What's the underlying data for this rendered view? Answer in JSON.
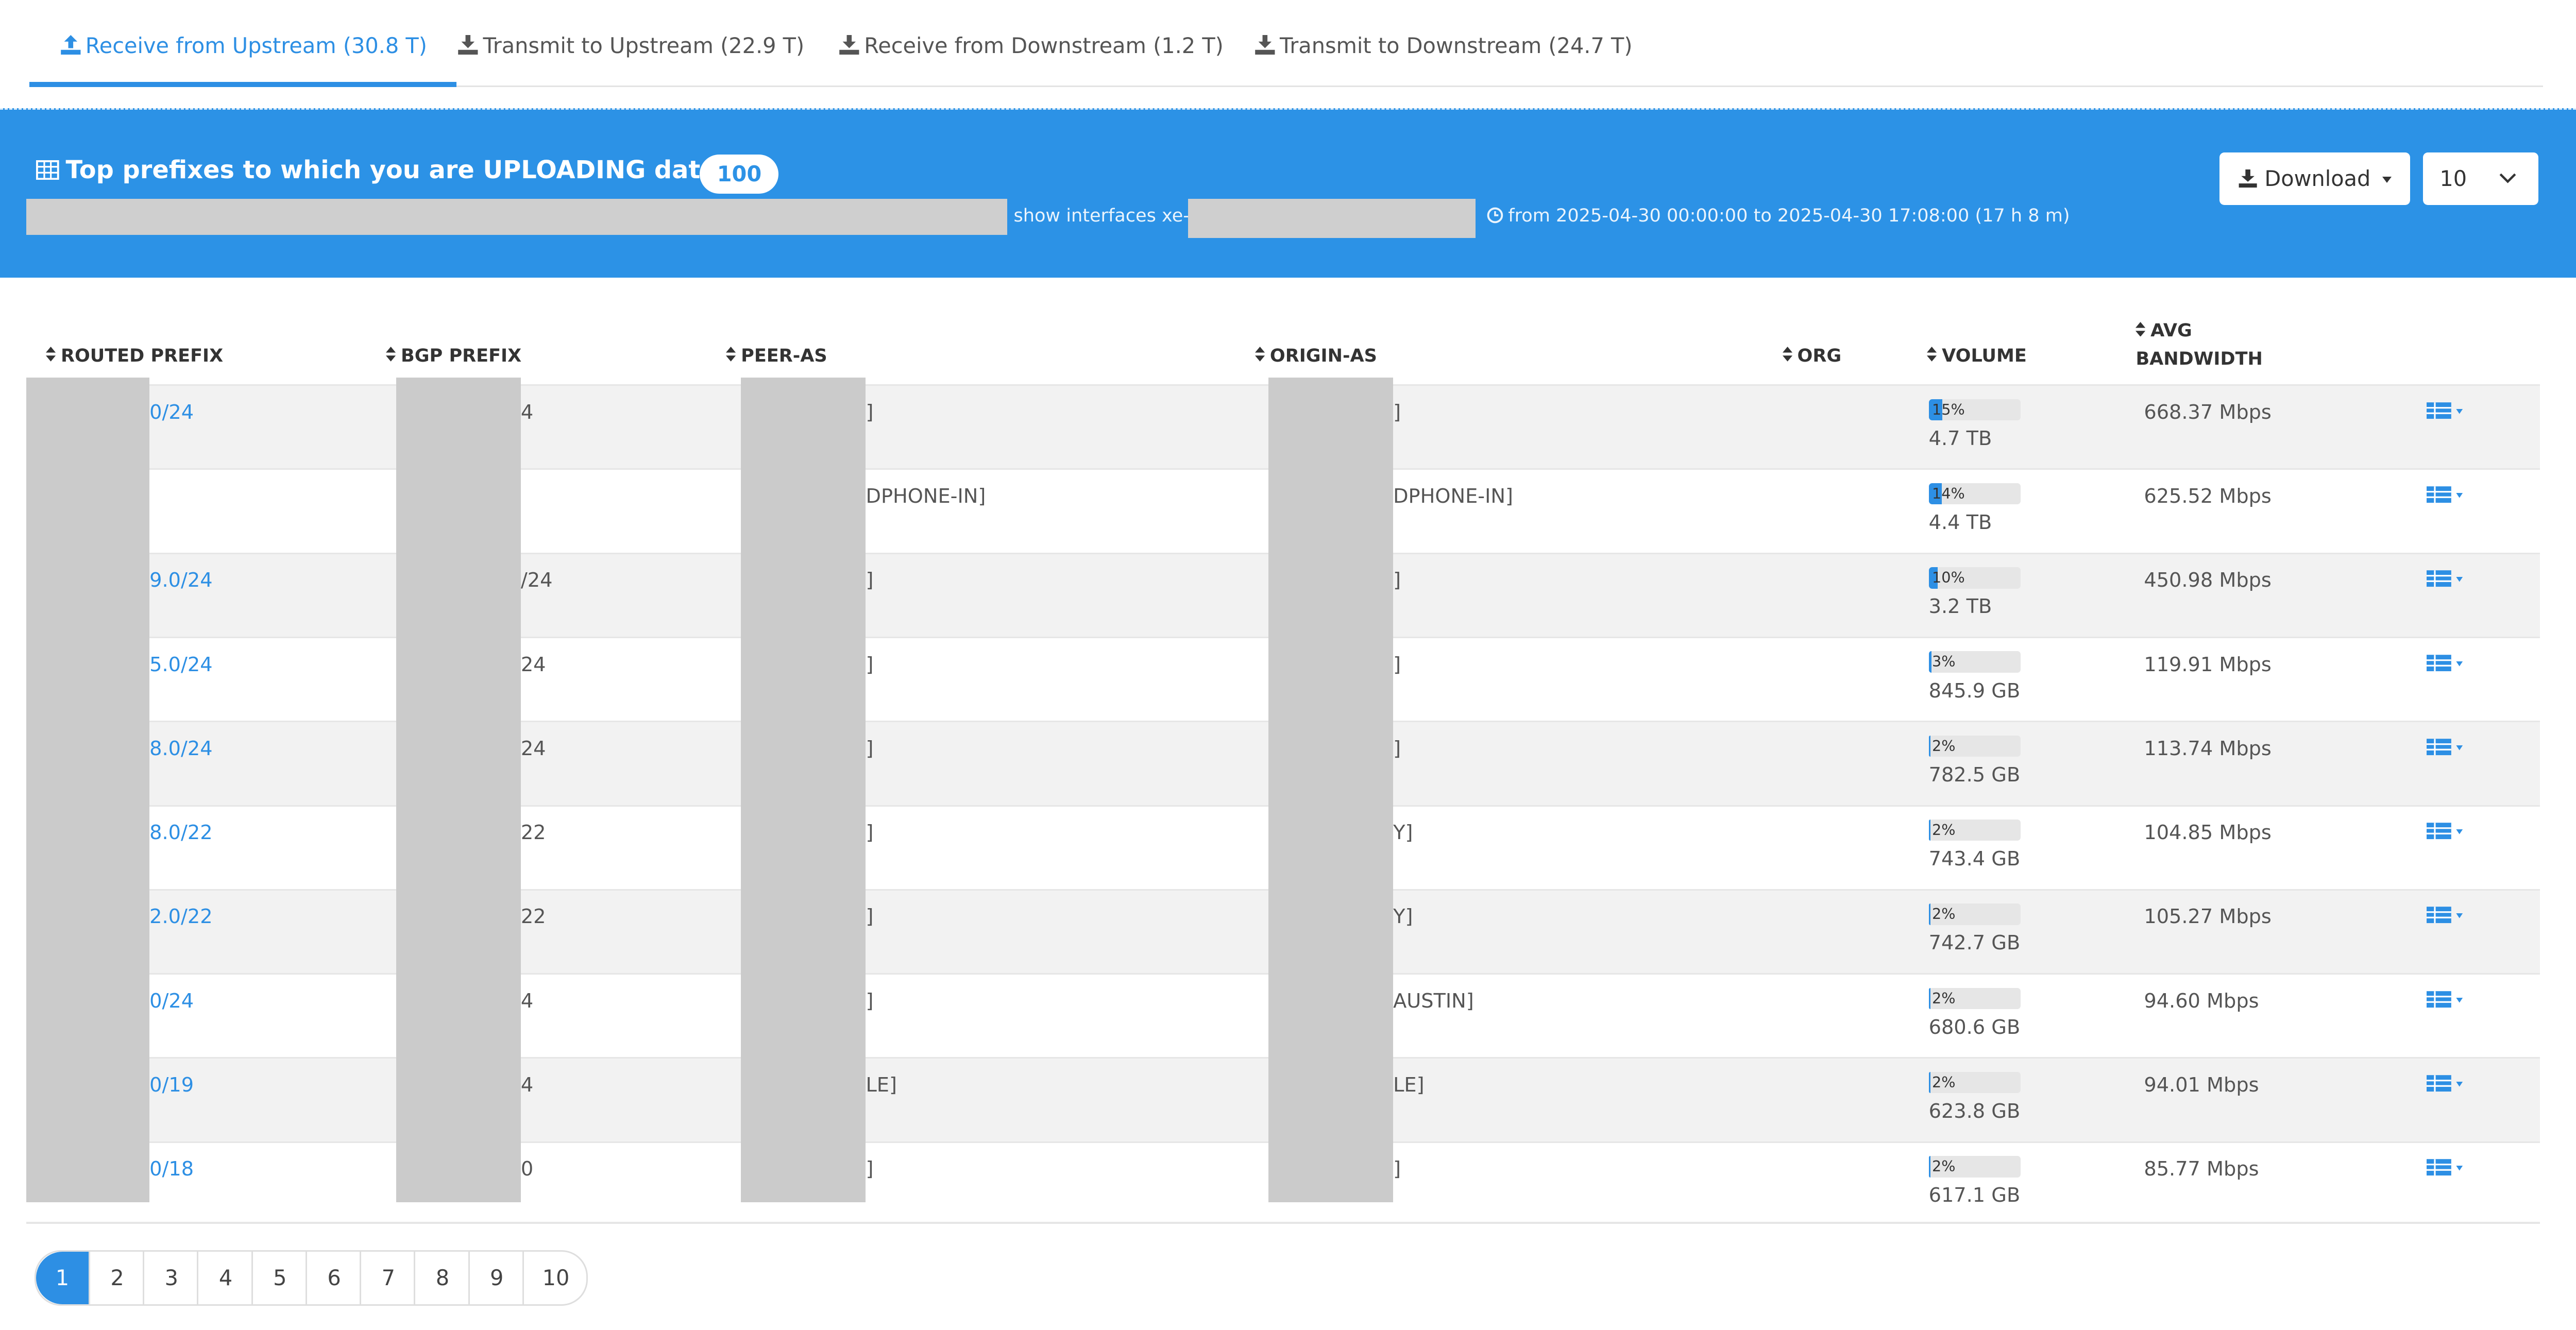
{
  "tabs": [
    {
      "label": "Receive from Upstream (30.8 T)",
      "active": true
    },
    {
      "label": "Transmit to Upstream (22.9 T)",
      "active": false
    },
    {
      "label": "Receive from Downstream (1.2 T)",
      "active": false
    },
    {
      "label": "Transmit to Downstream (24.7 T)",
      "active": false
    }
  ],
  "banner": {
    "title": "Top prefixes to which you are UPLOADING data",
    "count": "100",
    "interfaces_prefix": "show interfaces xe-",
    "time_range": "from 2025-04-30 00:00:00 to 2025-04-30 17:08:00 (17 h 8 m)",
    "download_label": "Download",
    "page_size": "10"
  },
  "columns": [
    "ROUTED PREFIX",
    "BGP PREFIX",
    "PEER-AS",
    "ORIGIN-AS",
    "ORG",
    "VOLUME",
    "AVG",
    "BANDWIDTH"
  ],
  "rows": [
    {
      "routed": "0/24",
      "bgp": "4",
      "peer": "]",
      "origin": "]",
      "pct": "15%",
      "pct_value": 15,
      "volume": "4.7 TB",
      "bandwidth": "668.37 Mbps"
    },
    {
      "routed": "",
      "bgp": "",
      "peer": "DPHONE-IN]",
      "origin": "DPHONE-IN]",
      "pct": "14%",
      "pct_value": 14,
      "volume": "4.4 TB",
      "bandwidth": "625.52 Mbps"
    },
    {
      "routed": "9.0/24",
      "bgp": "/24",
      "peer": "]",
      "origin": "]",
      "pct": "10%",
      "pct_value": 10,
      "volume": "3.2 TB",
      "bandwidth": "450.98 Mbps"
    },
    {
      "routed": "5.0/24",
      "bgp": "24",
      "peer": "]",
      "origin": "]",
      "pct": "3%",
      "pct_value": 3,
      "volume": "845.9 GB",
      "bandwidth": "119.91 Mbps"
    },
    {
      "routed": "8.0/24",
      "bgp": "24",
      "peer": "]",
      "origin": "]",
      "pct": "2%",
      "pct_value": 2,
      "volume": "782.5 GB",
      "bandwidth": "113.74 Mbps"
    },
    {
      "routed": "8.0/22",
      "bgp": "22",
      "peer": "]",
      "origin": "Y]",
      "pct": "2%",
      "pct_value": 2,
      "volume": "743.4 GB",
      "bandwidth": "104.85 Mbps"
    },
    {
      "routed": "2.0/22",
      "bgp": "22",
      "peer": "]",
      "origin": "Y]",
      "pct": "2%",
      "pct_value": 2,
      "volume": "742.7 GB",
      "bandwidth": "105.27 Mbps"
    },
    {
      "routed": "0/24",
      "bgp": "4",
      "peer": "]",
      "origin": "AUSTIN]",
      "pct": "2%",
      "pct_value": 2,
      "volume": "680.6 GB",
      "bandwidth": "94.60 Mbps"
    },
    {
      "routed": "0/19",
      "bgp": "4",
      "peer": "LE]",
      "origin": "LE]",
      "pct": "2%",
      "pct_value": 2,
      "volume": "623.8 GB",
      "bandwidth": "94.01 Mbps"
    },
    {
      "routed": "0/18",
      "bgp": "0",
      "peer": "]",
      "origin": "]",
      "pct": "2%",
      "pct_value": 2,
      "volume": "617.1 GB",
      "bandwidth": "85.77 Mbps"
    }
  ],
  "pagination": [
    "1",
    "2",
    "3",
    "4",
    "5",
    "6",
    "7",
    "8",
    "9",
    "10"
  ],
  "active_page": "1",
  "colors": {
    "accent": "#2d8fe4",
    "banner": "#2c92e6",
    "redaction": "#cbcbcb",
    "row_alt": "#f2f2f2"
  }
}
